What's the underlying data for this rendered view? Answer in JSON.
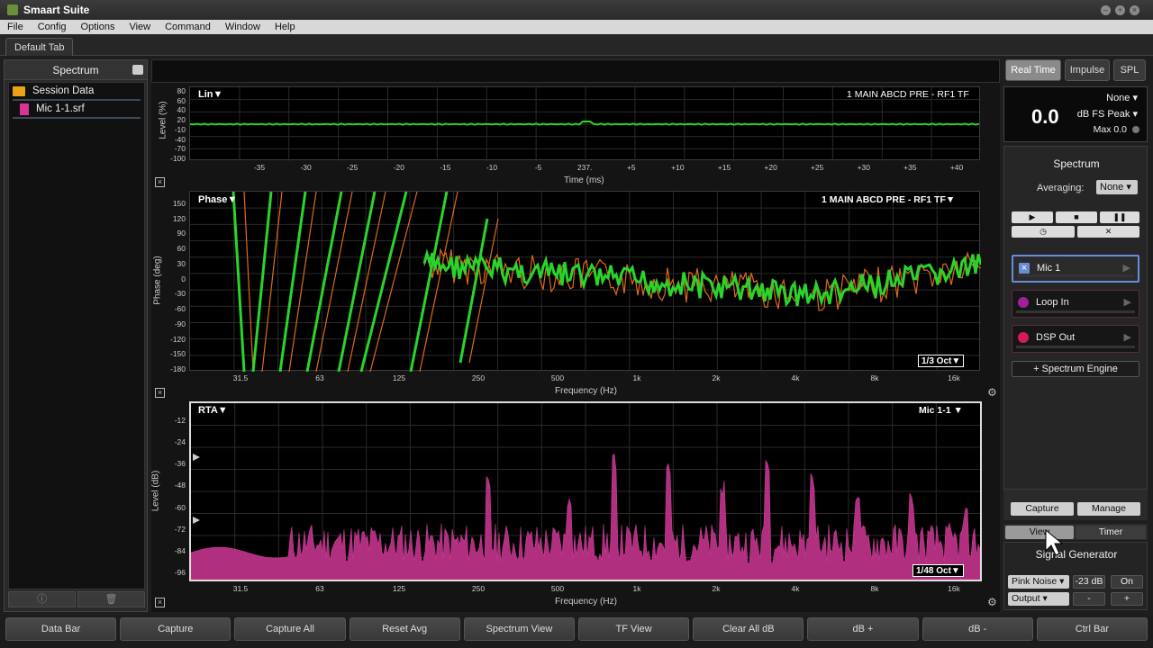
{
  "app": {
    "title": "Smaart Suite"
  },
  "menu": [
    "File",
    "Config",
    "Options",
    "View",
    "Command",
    "Window",
    "Help"
  ],
  "tabs": {
    "default": "Default Tab"
  },
  "left_panel": {
    "title": "Spectrum",
    "items": [
      {
        "label": "Session Data",
        "icon": "folder-icon"
      },
      {
        "label": "Mic 1-1.srf",
        "icon": "file-icon"
      }
    ],
    "bottom_icons": [
      "info-icon",
      "trash-icon"
    ]
  },
  "impulse_plot": {
    "label": "Lin▼",
    "trace": "1 MAIN ABCD PRE - RF1 TF",
    "y_title": "Level (%)",
    "x_title": "Time (ms)",
    "y_ticks": [
      "80",
      "60",
      "40",
      "20",
      "-10",
      "-40",
      "-70",
      "-100"
    ],
    "x_ticks": [
      "-35",
      "-30",
      "-25",
      "-20",
      "-15",
      "-10",
      "-5",
      "237.",
      "+5",
      "+10",
      "+15",
      "+20",
      "+25",
      "+30",
      "+35",
      "+40"
    ]
  },
  "phase_plot": {
    "label": "Phase▼",
    "trace": "1 MAIN ABCD PRE - RF1 TF▼",
    "y_title": "Phase (deg)",
    "x_title": "Frequency (Hz)",
    "y_ticks": [
      "150",
      "120",
      "90",
      "60",
      "30",
      "0",
      "-30",
      "-60",
      "-90",
      "-120",
      "-150",
      "-180"
    ],
    "x_ticks": [
      "31.5",
      "63",
      "125",
      "250",
      "500",
      "1k",
      "2k",
      "4k",
      "8k",
      "16k"
    ],
    "resolution": "1/3 Oct▼",
    "colors": {
      "live": "#2bd42b",
      "reference": "#e06a1a"
    }
  },
  "rta_plot": {
    "label": "RTA▼",
    "trace": "Mic 1-1 ▼",
    "y_title": "Level (dB)",
    "x_title": "Frequency (Hz)",
    "y_ticks": [
      "-12",
      "-24",
      "-36",
      "-48",
      "-60",
      "-72",
      "-84",
      "-96"
    ],
    "x_ticks": [
      "31.5",
      "63",
      "125",
      "250",
      "500",
      "1k",
      "2k",
      "4k",
      "8k",
      "16k"
    ],
    "resolution": "1/48 Oct▼",
    "colors": {
      "fill": "#b0307f"
    }
  },
  "right_panel": {
    "modes": [
      "Real Time",
      "Impulse",
      "SPL"
    ],
    "meter": {
      "weighting": "None",
      "value": "0.0",
      "scale": "dB FS Peak",
      "max": "Max 0.0"
    },
    "engine": {
      "title": "Spectrum",
      "averaging_label": "Averaging:",
      "averaging_value": "None",
      "measurements": [
        {
          "label": "Mic 1",
          "color": "#6a8cd8"
        },
        {
          "label": "Loop In",
          "color": "#a0209a"
        },
        {
          "label": "DSP Out",
          "color": "#d81a5a"
        }
      ],
      "add_label": "+ Spectrum Engine"
    },
    "capture": "Capture",
    "manage": "Manage",
    "view_label": "View",
    "timer": "Timer",
    "signal_generator": {
      "title": "Signal Generator",
      "type": "Pink Noise",
      "level": "-23 dB",
      "on": "On",
      "output": "Output",
      "minus": "-",
      "plus": "+"
    }
  },
  "bottom_bar": [
    "Data Bar",
    "Capture",
    "Capture All",
    "Reset Avg",
    "Spectrum View",
    "TF View",
    "Clear All dB",
    "dB +",
    "dB -",
    "Ctrl Bar"
  ]
}
